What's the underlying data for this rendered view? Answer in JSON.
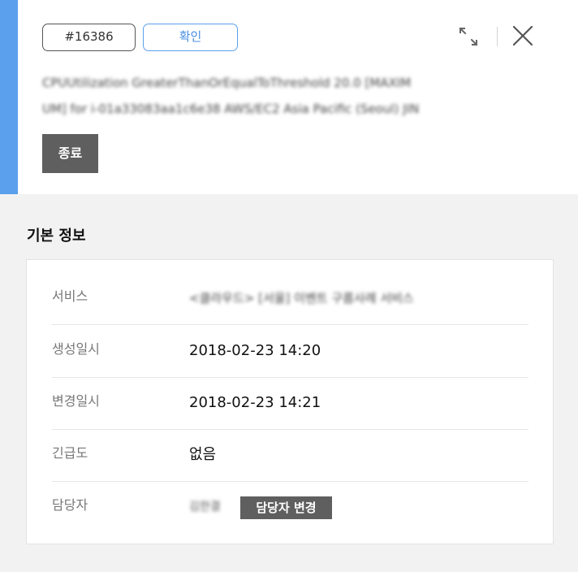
{
  "header": {
    "ticket_id": "#16386",
    "status_button": "확인",
    "title_lines": [
      "CPUUtilization GreaterThanOrEqualToThreshold 20.0 [MAXIM",
      "UM] for i-01a33083aa1c6e38 AWS/EC2 Asia Pacific (Seoul) JIN"
    ],
    "end_button": "종료",
    "accent_color": "#5aa0ec"
  },
  "icons": {
    "expand": "expand-icon",
    "close": "close-icon"
  },
  "section": {
    "title": "기본 정보"
  },
  "info": {
    "service_label": "서비스",
    "service_value": "<클라우드> [서울] 이벤트 구름사례 서비스",
    "created_label": "생성일시",
    "created_value": "2018-02-23 14:20",
    "modified_label": "변경일시",
    "modified_value": "2018-02-23 14:21",
    "urgency_label": "긴급도",
    "urgency_value": "없음",
    "assignee_label": "담당자",
    "assignee_value": "김한결",
    "assignee_button": "담당자 변경"
  }
}
